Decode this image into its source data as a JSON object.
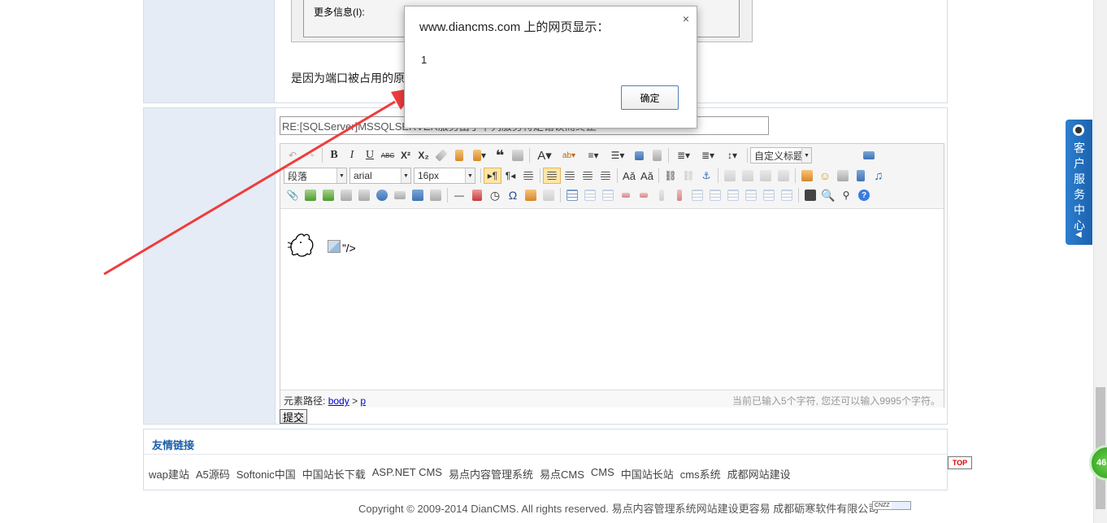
{
  "post": {
    "more_info_label": "更多信息(I):",
    "body_text": "是因为端口被占用的原"
  },
  "reply": {
    "title_value": "RE:[SQLServer]MSSQLSERVER服务由于下列服务特定错误而终止",
    "submit_label": "提交"
  },
  "editor": {
    "combos": {
      "paragraph": "段落",
      "font_family": "arial",
      "font_size": "16px",
      "custom_heading": "自定义标题"
    },
    "content_tail": "”/>",
    "path_label": "元素路径:",
    "path_body": "body",
    "path_sep": ">",
    "path_p": "p",
    "char_count": "当前已输入5个字符, 您还可以输入9995个字符。"
  },
  "friend_links": {
    "title": "友情链接",
    "items": [
      "wap建站",
      "A5源码",
      "Softonic中国",
      "中国站长下载",
      "ASP.NET CMS",
      "易点内容管理系统",
      "易点CMS",
      "CMS",
      "中国站长站",
      "cms系统",
      "成都网站建设"
    ]
  },
  "footer": {
    "copyright": "Copyright © 2009-2014 DianCMS. All rights reserved. 易点内容管理系统网站建设更容易 成都砺寒软件有限公司",
    "cnzz": "CNZZ"
  },
  "top_button": "TOP",
  "service": {
    "text": "客户服务中心",
    "arrow": "◀"
  },
  "badge": "46",
  "dialog": {
    "title": "www.diancms.com 上的网页显示：",
    "close": "×",
    "message": "1",
    "ok_label": "确定"
  },
  "colors": {
    "panel_bg": "#e5ecf5",
    "link_title": "#1c5fa8",
    "arrow": "#f03c3c",
    "service_tab": "#1a62ad"
  }
}
